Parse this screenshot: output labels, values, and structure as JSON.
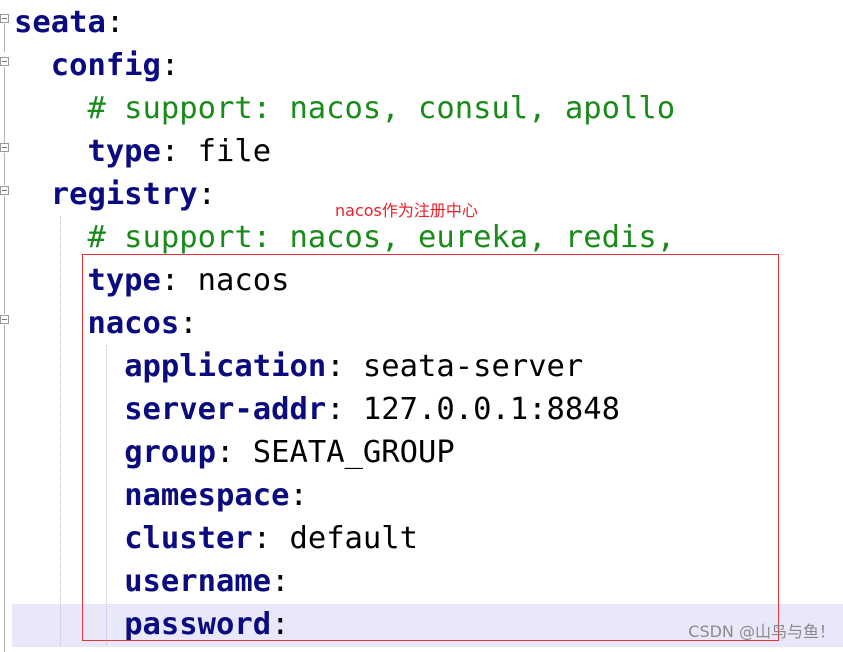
{
  "editor": {
    "lines": [
      {
        "indent": "",
        "key": "seata",
        "sep": ":",
        "value": ""
      },
      {
        "indent": "  ",
        "key": "config",
        "sep": ":",
        "value": ""
      },
      {
        "indent": "    ",
        "comment": "# support: nacos, consul, apollo"
      },
      {
        "indent": "    ",
        "key": "type",
        "sep": ":",
        "value": " file"
      },
      {
        "indent": "  ",
        "key": "registry",
        "sep": ":",
        "value": ""
      },
      {
        "indent": "    ",
        "comment": "# support: nacos, eureka, redis,"
      },
      {
        "indent": "    ",
        "key": "type",
        "sep": ":",
        "value": " nacos"
      },
      {
        "indent": "    ",
        "key": "nacos",
        "sep": ":",
        "value": ""
      },
      {
        "indent": "      ",
        "key": "application",
        "sep": ":",
        "value": " seata-server"
      },
      {
        "indent": "      ",
        "key": "server-addr",
        "sep": ":",
        "value": " 127.0.0.1:8848"
      },
      {
        "indent": "      ",
        "key": "group",
        "sep": ":",
        "value": " SEATA_GROUP"
      },
      {
        "indent": "      ",
        "key": "namespace",
        "sep": ":",
        "value": ""
      },
      {
        "indent": "      ",
        "key": "cluster",
        "sep": ":",
        "value": " default"
      },
      {
        "indent": "      ",
        "key": "username",
        "sep": ":",
        "value": ""
      },
      {
        "indent": "      ",
        "key": "password",
        "sep": ":",
        "value": ""
      }
    ]
  },
  "annotation": {
    "label": "nacos作为注册中心",
    "color": "#e8232a"
  },
  "watermark": "CSDN @山鸟与鱼！",
  "colors": {
    "keyword": "#0b0b80",
    "comment": "#1a8a1a",
    "current_line": "#e8e8fa"
  }
}
